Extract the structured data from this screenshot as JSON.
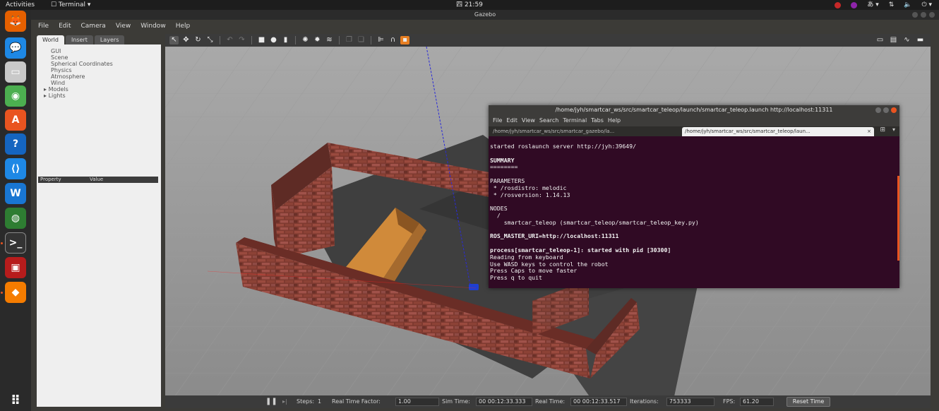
{
  "topbar": {
    "activities": "Activities",
    "app_menu": "☐ Terminal ▾",
    "clock": "四 21:59",
    "tray_colors": [
      "#c62828",
      "#8e24aa"
    ]
  },
  "dock": {
    "items": [
      {
        "name": "firefox-icon",
        "color": "#e66000",
        "glyph": "🦊"
      },
      {
        "name": "chat-icon",
        "color": "#1e88e5",
        "glyph": "💬"
      },
      {
        "name": "files-icon",
        "color": "#c9c9c9",
        "glyph": "▭"
      },
      {
        "name": "install-icon",
        "color": "#4caf50",
        "glyph": "◉"
      },
      {
        "name": "software-center-icon",
        "color": "#e95420",
        "glyph": "A"
      },
      {
        "name": "help-icon",
        "color": "#1565c0",
        "glyph": "?"
      },
      {
        "name": "vscode-icon",
        "color": "#1e88e5",
        "glyph": "⟨⟩"
      },
      {
        "name": "wps-icon",
        "color": "#1976d2",
        "glyph": "W"
      },
      {
        "name": "globe-icon",
        "color": "#2e7d32",
        "glyph": "◍"
      },
      {
        "name": "terminal-icon",
        "color": "#333333",
        "glyph": ">_"
      },
      {
        "name": "remote-desktop-icon",
        "color": "#b71c1c",
        "glyph": "▣"
      },
      {
        "name": "gazebo-icon",
        "color": "#f57c00",
        "glyph": "◆"
      }
    ],
    "apps_grid_glyph": "⠿"
  },
  "gazebo": {
    "title": "Gazebo",
    "menu": [
      "File",
      "Edit",
      "Camera",
      "View",
      "Window",
      "Help"
    ],
    "left_tabs": [
      "World",
      "Insert",
      "Layers"
    ],
    "tree": [
      "GUI",
      "Scene",
      "Spherical Coordinates",
      "Physics",
      "Atmosphere",
      "Wind"
    ],
    "tree_expandable": [
      "Models",
      "Lights"
    ],
    "property_header": [
      "Property",
      "Value"
    ],
    "bottom": {
      "pause_icon": "❚❚",
      "steps_label": "Steps:",
      "steps_value": "1",
      "rtf_label": "Real Time Factor:",
      "rtf_value": "1.00",
      "sim_time_label": "Sim Time:",
      "sim_time_value": "00 00:12:33.333",
      "real_time_label": "Real Time:",
      "real_time_value": "00 00:12:33.517",
      "iterations_label": "Iterations:",
      "iterations_value": "753333",
      "fps_label": "FPS:",
      "fps_value": "61.20",
      "reset_label": "Reset Time"
    }
  },
  "terminal": {
    "title": "/home/jyh/smartcar_ws/src/smartcar_teleop/launch/smartcar_teleop.launch http://localhost:11311",
    "menu": [
      "File",
      "Edit",
      "View",
      "Search",
      "Terminal",
      "Tabs",
      "Help"
    ],
    "tab1": "/home/jyh/smartcar_ws/src/smartcar_gazebo/la...",
    "tab2": "/home/jyh/smartcar_ws/src/smartcar_teleop/laun...",
    "tab_close": "×",
    "lines": [
      {
        "t": "started roslaunch server http://jyh:39649/",
        "b": false
      },
      {
        "t": "",
        "b": false
      },
      {
        "t": "SUMMARY",
        "b": true
      },
      {
        "t": "========",
        "b": false
      },
      {
        "t": "",
        "b": false
      },
      {
        "t": "PARAMETERS",
        "b": false
      },
      {
        "t": " * /rosdistro: melodic",
        "b": false
      },
      {
        "t": " * /rosversion: 1.14.13",
        "b": false
      },
      {
        "t": "",
        "b": false
      },
      {
        "t": "NODES",
        "b": false
      },
      {
        "t": "  /",
        "b": false
      },
      {
        "t": "    smartcar_teleop (smartcar_teleop/smartcar_teleop_key.py)",
        "b": false
      },
      {
        "t": "",
        "b": false
      },
      {
        "t": "ROS_MASTER_URI=http://localhost:11311",
        "b": true
      },
      {
        "t": "",
        "b": false
      },
      {
        "t": "process[smartcar_teleop-1]: started with pid [30300]",
        "b": true
      },
      {
        "t": "Reading from keyboard",
        "b": false
      },
      {
        "t": "Use WASD keys to control the robot",
        "b": false
      },
      {
        "t": "Press Caps to move faster",
        "b": false
      },
      {
        "t": "Press q to quit",
        "b": false
      }
    ]
  }
}
